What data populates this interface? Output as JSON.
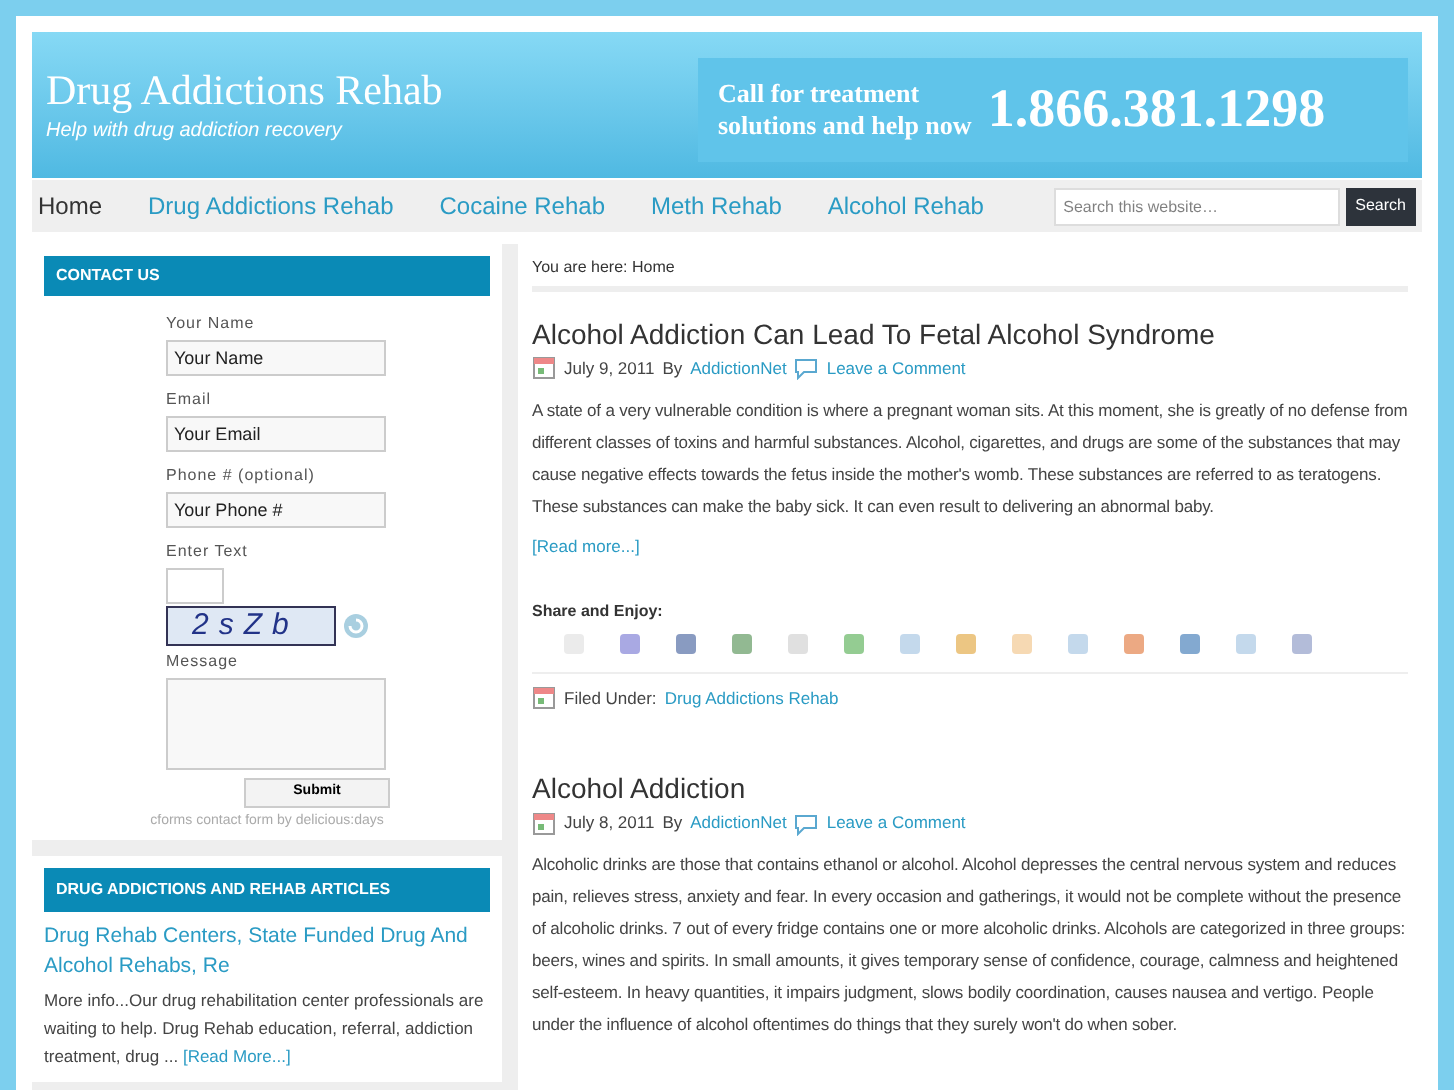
{
  "header": {
    "title": "Drug Addictions Rehab",
    "tagline": "Help with drug addiction recovery",
    "callout": {
      "text_line_1": "Call for treatment",
      "text_line_2": "solutions and help now",
      "phone": "1.866.381.1298"
    }
  },
  "nav": {
    "items": [
      {
        "label": "Home",
        "selected": true
      },
      {
        "label": "Drug Addictions Rehab",
        "selected": false
      },
      {
        "label": "Cocaine Rehab",
        "selected": false
      },
      {
        "label": "Meth Rehab",
        "selected": false
      },
      {
        "label": "Alcohol Rehab",
        "selected": false
      }
    ],
    "search": {
      "placeholder": "Search this website…",
      "button": "Search"
    }
  },
  "sidebar": {
    "contact": {
      "heading": "CONTACT US",
      "fields": [
        {
          "label": "Your Name",
          "value": "Your Name",
          "kind": "text"
        },
        {
          "label": "Email",
          "value": "Your Email",
          "kind": "text"
        },
        {
          "label": "Phone # (optional)",
          "value": "Your Phone #",
          "kind": "text"
        },
        {
          "label": "Enter Text",
          "kind": "captcha",
          "captcha": "2sZb"
        },
        {
          "label": "Message",
          "kind": "textarea"
        }
      ],
      "submit": "Submit",
      "credit": "cforms contact form by delicious:days"
    },
    "articles": {
      "heading": "DRUG ADDICTIONS AND REHAB ARTICLES",
      "items": [
        {
          "title": "Drug Rehab Centers, State Funded Drug And Alcohol Rehabs, Re",
          "excerpt": "More info...Our drug rehabilitation center professionals are waiting to help. Drug Rehab education, referral, addiction treatment, drug ...",
          "more": "[Read More...]"
        }
      ]
    }
  },
  "breadcrumb": "You are here: Home",
  "posts": [
    {
      "title": "Alcohol Addiction Can Lead To Fetal Alcohol Syndrome",
      "date": "July 9, 2011",
      "by": "By",
      "author": "AddictionNet",
      "comment": "Leave a Comment",
      "body": "A state of a very vulnerable condition is where a pregnant woman sits. At this moment, she is greatly of no defense from different classes of toxins and harmful substances. Alcohol, cigarettes, and drugs are some of the substances that may cause negative effects towards the fetus inside the mother's womb. These substances are referred to as teratogens. These substances can make the baby sick. It can even result to delivering an abnormal baby.",
      "more": "[Read more...]",
      "share": "Share and Enjoy:",
      "filed_label": "Filed Under:",
      "filed_category": "Drug Addictions Rehab"
    },
    {
      "title": "Alcohol Addiction",
      "date": "July 8, 2011",
      "by": "By",
      "author": "AddictionNet",
      "comment": "Leave a Comment",
      "body": "Alcoholic drinks are those that contains ethanol or alcohol. Alcohol depresses the central nervous system and reduces pain, relieves stress, anxiety and fear. In every occasion and gatherings, it would not be complete without the presence of alcoholic drinks. 7 out of every fridge contains one or more alcoholic drinks. Alcohols are categorized in three groups: beers, wines and spirits. In small amounts, it gives temporary sense of confidence, courage, calmness and heightened self-esteem. In heavy quantities, it impairs judgment, slows bodily coordination, causes nausea and vertigo. People under the influence of alcohol oftentimes do things that they surely won't do when sober."
    }
  ]
}
